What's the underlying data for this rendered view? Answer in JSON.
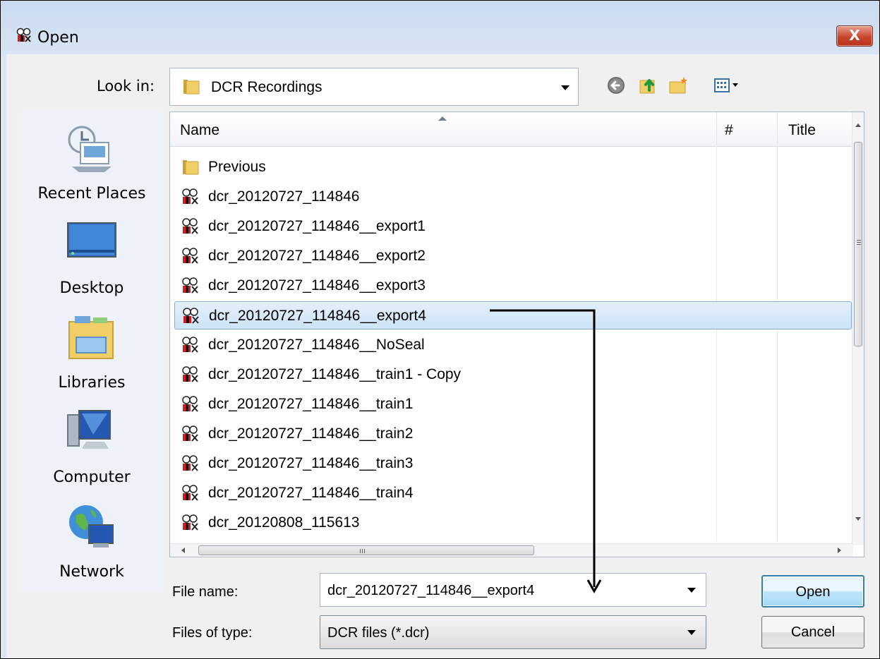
{
  "window": {
    "title": "Open",
    "close_symbol": "X"
  },
  "toolbar": {
    "look_in_label": "Look in:",
    "look_in_value": "DCR Recordings",
    "icons": [
      "back-icon",
      "up-folder-icon",
      "new-folder-icon",
      "view-menu-icon"
    ]
  },
  "places": [
    {
      "label": "Recent Places",
      "icon": "recent-places-icon"
    },
    {
      "label": "Desktop",
      "icon": "desktop-icon"
    },
    {
      "label": "Libraries",
      "icon": "libraries-icon"
    },
    {
      "label": "Computer",
      "icon": "computer-icon"
    },
    {
      "label": "Network",
      "icon": "network-icon"
    }
  ],
  "file_list": {
    "columns": [
      "Name",
      "#",
      "Title"
    ],
    "items": [
      {
        "name": "Previous",
        "type": "folder"
      },
      {
        "name": "dcr_20120727_114846",
        "type": "dcr"
      },
      {
        "name": "dcr_20120727_114846__export1",
        "type": "dcr"
      },
      {
        "name": "dcr_20120727_114846__export2",
        "type": "dcr"
      },
      {
        "name": "dcr_20120727_114846__export3",
        "type": "dcr"
      },
      {
        "name": "dcr_20120727_114846__export4",
        "type": "dcr",
        "selected": true
      },
      {
        "name": "dcr_20120727_114846__NoSeal",
        "type": "dcr"
      },
      {
        "name": "dcr_20120727_114846__train1 - Copy",
        "type": "dcr"
      },
      {
        "name": "dcr_20120727_114846__train1",
        "type": "dcr"
      },
      {
        "name": "dcr_20120727_114846__train2",
        "type": "dcr"
      },
      {
        "name": "dcr_20120727_114846__train3",
        "type": "dcr"
      },
      {
        "name": "dcr_20120727_114846__train4",
        "type": "dcr"
      },
      {
        "name": "dcr_20120808_115613",
        "type": "dcr"
      }
    ]
  },
  "filename": {
    "label": "File name:",
    "value": "dcr_20120727_114846__export4"
  },
  "filetype": {
    "label": "Files of type:",
    "value": "DCR files (*.dcr)"
  },
  "buttons": {
    "open": "Open",
    "cancel": "Cancel"
  },
  "colors": {
    "selection": "#cde3f7",
    "close_button": "#c9462e",
    "dialog_frame": "#dbe6f3"
  }
}
